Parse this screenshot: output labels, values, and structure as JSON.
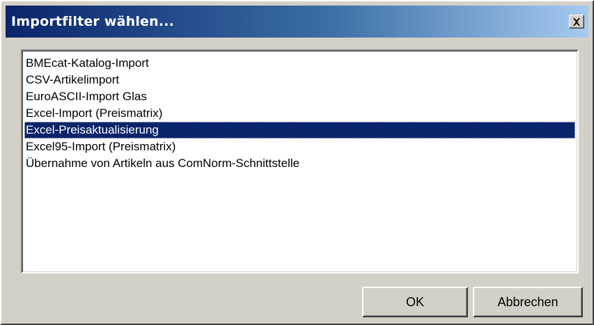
{
  "window": {
    "title": "Importfilter wählen..."
  },
  "titlebar": {
    "close_icon": "close-icon"
  },
  "filter_list": {
    "items": [
      {
        "label": "BMEcat-Katalog-Import",
        "selected": false
      },
      {
        "label": "CSV-Artikelimport",
        "selected": false
      },
      {
        "label": "EuroASCII-Import Glas",
        "selected": false
      },
      {
        "label": "Excel-Import (Preismatrix)",
        "selected": false
      },
      {
        "label": "Excel-Preisaktualisierung",
        "selected": true
      },
      {
        "label": "Excel95-Import (Preismatrix)",
        "selected": false
      },
      {
        "label": "Übernahme von Artikeln aus ComNorm-Schnittstelle",
        "selected": false
      }
    ],
    "selection_color": "#0a246a"
  },
  "buttons": {
    "ok_label": "OK",
    "cancel_label": "Abbrechen"
  },
  "colors": {
    "title_gradient_start": "#0a246a",
    "title_gradient_end": "#a6caf0",
    "dialog_background": "#d4d0c8"
  }
}
